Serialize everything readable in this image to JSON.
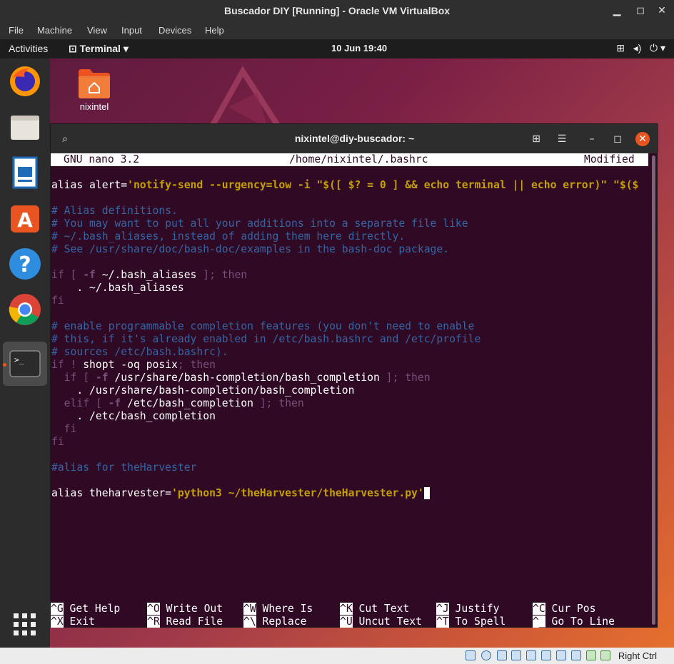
{
  "vbox": {
    "title": "Buscador DIY [Running] - Oracle VM VirtualBox",
    "menu": [
      "File",
      "Machine",
      "View",
      "Input",
      "Devices",
      "Help"
    ],
    "status_hostkey": "Right Ctrl"
  },
  "gnome": {
    "activities": "Activities",
    "app_menu": "Terminal",
    "clock": "10 Jun  19:40"
  },
  "desktop": {
    "icon_label": "nixintel"
  },
  "dock": [
    "firefox-icon",
    "files-icon",
    "writer-icon",
    "software-icon",
    "help-icon",
    "chrome-icon",
    "terminal-icon",
    "app-grid-icon"
  ],
  "terminal": {
    "title": "nixintel@diy-buscador: ~",
    "nano": {
      "version": "GNU nano 3.2",
      "file": "/home/nixintel/.bashrc",
      "state": "Modified"
    },
    "lines": {
      "l0a": "alias alert=",
      "l0b": "'notify-send --urgency=low -i \"$([ $? = 0 ] && echo terminal || echo error)\" \"$($",
      "l2": "# Alias definitions.",
      "l3": "# You may want to put all your additions into a separate file like",
      "l4": "# ~/.bash_aliases, instead of adding them here directly.",
      "l5": "# See /usr/share/doc/bash-doc/examples in the bash-doc package.",
      "l7a": "if [ ",
      "l7b": "-f",
      "l7c": " ~/.bash_aliases ",
      "l7d": "]; then",
      "l8": "    . ~/.bash_aliases",
      "l9": "fi",
      "l11": "# enable programmable completion features (you don't need to enable",
      "l12": "# this, if it's already enabled in /etc/bash.bashrc and /etc/profile",
      "l13": "# sources /etc/bash.bashrc).",
      "l14a": "if ! ",
      "l14b": "shopt -oq posix",
      "l14c": "; then",
      "l15a": "  if [ ",
      "l15b": "-f",
      "l15c": " /usr/share/bash-completion/bash_completion ",
      "l15d": "]; then",
      "l16": "    . /usr/share/bash-completion/bash_completion",
      "l17a": "  elif [ ",
      "l17b": "-f",
      "l17c": " /etc/bash_completion ",
      "l17d": "]; then",
      "l18": "    . /etc/bash_completion",
      "l19": "  fi",
      "l20": "fi",
      "l22": "#alias for theHarvester",
      "l24a": "alias theharvester=",
      "l24b": "'python3 ~/theHarvester/theHarvester.py'"
    },
    "shortcuts": [
      {
        "key": "^G",
        "label": "Get Help"
      },
      {
        "key": "^O",
        "label": "Write Out"
      },
      {
        "key": "^W",
        "label": "Where Is"
      },
      {
        "key": "^K",
        "label": "Cut Text"
      },
      {
        "key": "^J",
        "label": "Justify"
      },
      {
        "key": "^C",
        "label": "Cur Pos"
      },
      {
        "key": "^X",
        "label": "Exit"
      },
      {
        "key": "^R",
        "label": "Read File"
      },
      {
        "key": "^\\",
        "label": "Replace"
      },
      {
        "key": "^U",
        "label": "Uncut Text"
      },
      {
        "key": "^T",
        "label": "To Spell"
      },
      {
        "key": "^_",
        "label": "Go To Line"
      }
    ]
  },
  "colors": {
    "terminal_bg": "#300a24",
    "ubuntu_orange": "#e95420",
    "comment": "#3465a4",
    "string": "#c4a000",
    "keyword": "#75507b"
  }
}
